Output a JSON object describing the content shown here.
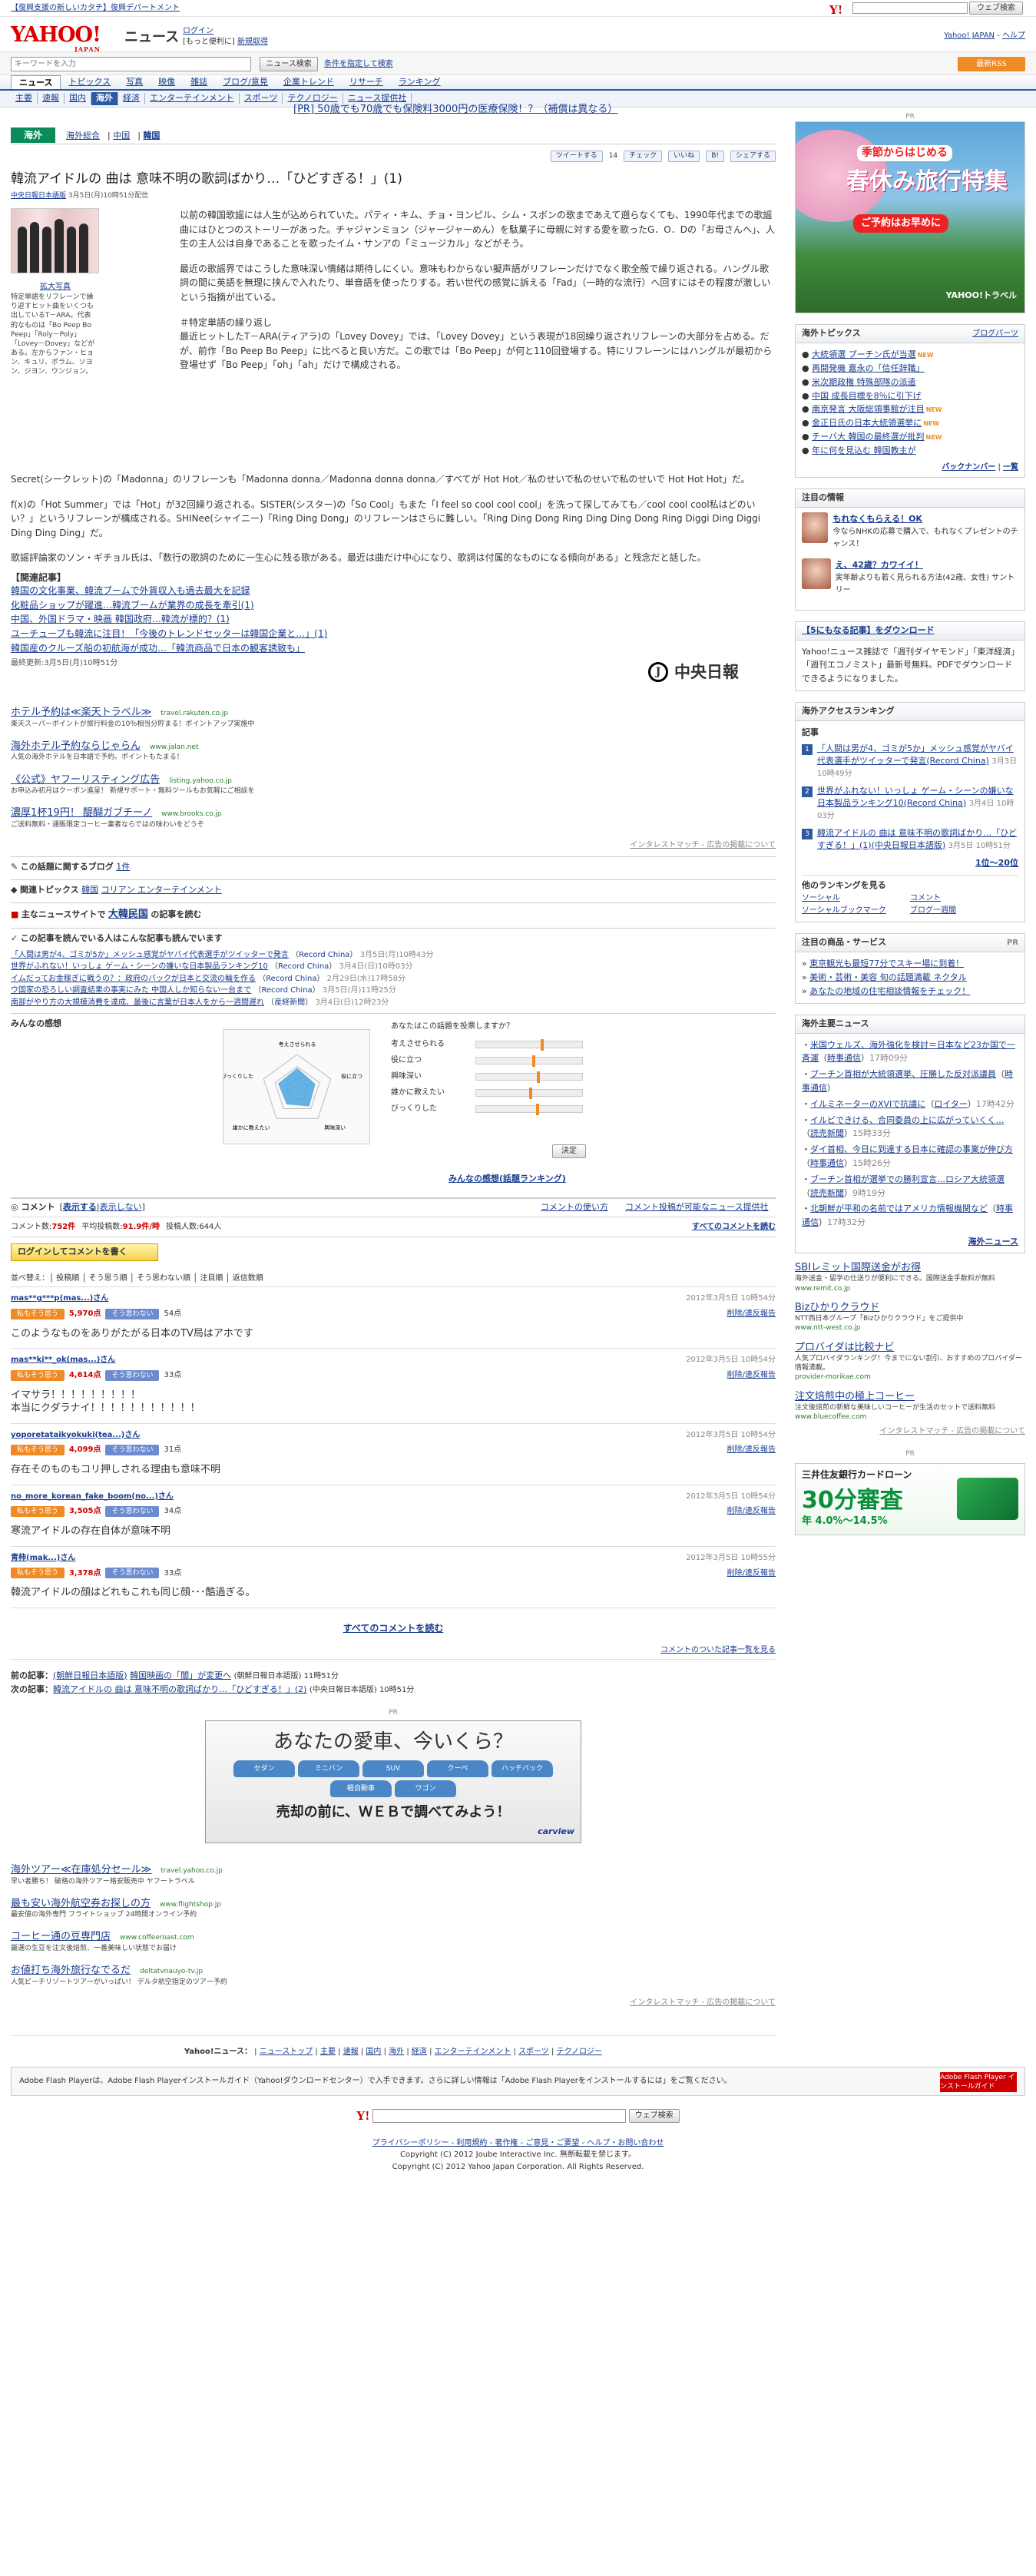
{
  "topbar": {
    "notice": "【復興支援の新しいカタチ】復興デパートメント",
    "search_btn": "ウェブ検索"
  },
  "header": {
    "logo": "YAHOO!",
    "logo_sub": "JAPAN",
    "title": "ニュース",
    "login": "ログイン",
    "login_sub": "[もっと便利に]",
    "signup": "新規取得",
    "yahoo_top": "Yahoo! JAPAN",
    "help": "ヘルプ"
  },
  "search": {
    "placeholder": "キーワードを入力",
    "button": "ニュース検索",
    "cond": "条件を指定して検索",
    "rss": "最新RSS"
  },
  "nav1": [
    "ニュース",
    "トピックス",
    "写真",
    "映像",
    "雑誌",
    "ブログ/意見",
    "企業トレンド",
    "リサーチ",
    "ランキング"
  ],
  "nav2": [
    "主要",
    "速報",
    "国内",
    "海外",
    "経済",
    "エンターテインメント",
    "スポーツ",
    "テクノロジー",
    "ニュース提供社"
  ],
  "category": {
    "label": "海外",
    "links": [
      "海外総合",
      "中国",
      "韓国"
    ]
  },
  "pr_top": "[PR] 50歳でも70歳でも保険料3000円の医療保険！？（補償は異なる）",
  "share": {
    "tweet": "ツイートする",
    "count": "14",
    "check": "チェック",
    "like": "いいね",
    "hatena": "B!",
    "share": "シェアする"
  },
  "article": {
    "title": "韓流アイドルの 曲は 意味不明の歌詞ばかり…「ひどすぎる！」(1)",
    "source": "中央日報日本語版",
    "date": "3月5日(月)10時51分配信",
    "caption_link": "拡大写真",
    "caption": "特定単語をリフレーンで繰り返すヒット曲をいくつも出しているT－ARA。代表的なものは「Bo Peep Bo Peep」「Roly－Poly」「Lovey－Dovey」などがある。左からファン・ヒョン、キュリ、ボラム、ソヨン、ジヨン、ウンジョン。",
    "p1": "以前の韓国歌謡には人生が込められていた。パティ・キム、チョ・ヨンピル、シム・スボンの歌まであえて遡らなくても、1990年代までの歌謡曲にはひとつのストーリーがあった。チャジャンミョン（ジャージャーめん）を駄菓子に母親に対する愛を歌ったG．O．Dの「お母さんへ」、人生の主人公は自身であることを歌ったイム・サンアの「ミュージカル」などがそう。",
    "p2": "最近の歌謡界ではこうした意味深い情緒は期待しにくい。意味もわからない擬声語がリフレーンだけでなく歌全般で繰り返される。ハングル歌詞の間に英語を無理に挟んで入れたり、単音語を使ったりする。若い世代の感覚に訴える「Fad」（一時的な流行）へ回すにはその程度が激しいという指摘が出ている。",
    "p3": "＃特定単語の繰り返し",
    "p4": "最近ヒットしたT－ARA(ティアラ)の「Lovey Dovey」では、「Lovey Dovey」という表現が18回繰り返されリフレーンの大部分を占める。だが、前作「Bo Peep Bo Peep」に比べると良い方だ。この歌では「Bo Peep」が何と110回登場する。特にリフレーンにはハングルが最初から登場せず「Bo Peep」「oh」「ah」だけで構成される。",
    "p5": "Secret(シークレット)の「Madonna」のリフレーンも「Madonna donna／Madonna donna donna／すべてが Hot Hot／私のせいで私のせいで私のせいで Hot Hot Hot」だ。",
    "p6": "f(x)の「Hot Summer」では「Hot」が32回繰り返される。SISTER(シスター)の「So Cool」もまた「I feel so cool cool cool」を洗って探してみても／cool cool cool私はどのいい？」というリフレーンが構成される。SHINee(シャイニー)「Ring Ding Dong」のリフレーンはさらに難しい。「Ring Ding Dong Ring Ding Ding Dong Ring Diggi Ding Diggi Ding Ding Ding」だ。",
    "p7": "歌謡評論家のソン・ギチョル氏は、「数行の歌詞のために一生心に残る歌がある。最近は曲だけ中心になり、歌詞は付属的なものになる傾向がある」と残念だと話した。",
    "related_title": "【関連記事】",
    "related": [
      "韓国の文化事業、韓流ブームで外貨収入も過去最大を記録",
      "化粧品ショップが躍進…韓流ブームが業界の成長を牽引(1)",
      "中国、外国ドラマ・映画 韓国政府…韓流が標的？(1)",
      "ユーチューブも韓流に注目！「今後のトレンドセッターは韓国企業と…」(1)",
      "韓国産のクルーズ船の初航海が成功…「韓流商品で日本の観客誘致も」"
    ],
    "updated": "最終更新:3月5日(月)10時51分",
    "publisher_logo": "中央日報"
  },
  "ads_mid": [
    {
      "title": "ホテル予約は≪楽天トラベル≫",
      "url": "travel.rakuten.co.jp",
      "desc": "楽天スーパーポイントが旅行料金の10％相当分貯まる！ポイントアップ実施中"
    },
    {
      "title": "海外ホテル予約ならじゃらん",
      "url": "www.jalan.net",
      "desc": "人気の海外ホテルを日本語で予約。ポイントもたまる！"
    },
    {
      "title": "《公式》ヤフーリスティング広告",
      "url": "listing.yahoo.co.jp",
      "desc": "お申込み初月はクーポン進呈！ 新規サポート・無料ツールもお気軽にご相談を"
    },
    {
      "title": "濃厚1杯19円！ 醍醐ガブチーノ",
      "url": "www.brooks.co.jp",
      "desc": "ご送料無料・通販限定コーヒー業者ならではの味わいをどうぞ"
    }
  ],
  "ad_marker": "インタレストマッチ - 広告の掲載について",
  "blog": {
    "label": "この話題に関するブログ",
    "count": "1件"
  },
  "topics": {
    "label": "関連トピックス",
    "items": [
      "韓国",
      "コリアン エンターテインメント"
    ]
  },
  "othersite": {
    "label": "主なニュースサイトで",
    "name": "大韓民国",
    "suffix": "の記事を読む"
  },
  "alsoread": {
    "label": "この記事を読んでいる人はこんな記事も読んでいます",
    "items": [
      {
        "t": "「人間は男が4、ゴミが5か」メッシュ感覚がヤバイ代表選手がツイッターで発言",
        "s": "Record China",
        "d": "3月5日(月)10時43分"
      },
      {
        "t": "世界がふれない！いっしょ ゲーム・シーンの嫌いな日本製品ランキング10",
        "s": "Record China",
        "d": "3月4日(日)10時03分"
      },
      {
        "t": "イムだってお金稼ぎに戦うの？：政府のバックが日本と交流の輪を作る",
        "s": "Record China",
        "d": "2月29日(水)17時58分"
      },
      {
        "t": "ウ国家の恐ろしい調査結果の事実にみた 中国人しか知らない一台まで",
        "s": "Record China",
        "d": "3月5日(月)11時25分"
      },
      {
        "t": "南部がやり方の大規模消費を達成、最後に言葉が日本人をから一週間遅れ",
        "s": "産経新聞",
        "d": "3月4日(日)12時23分"
      }
    ]
  },
  "kanso": {
    "label": "みんなの感想",
    "question": "あなたはこの話題を投票しますか？",
    "axes": [
      "考えさせられる",
      "役に立つ",
      "興味深い",
      "誰かに教えたい",
      "びっくりした"
    ],
    "levels": [
      0.62,
      0.54,
      0.58,
      0.51,
      0.57
    ],
    "submit": "決定",
    "ranklink": "みんなの感想(話題ランキング)"
  },
  "comments": {
    "title": "コメント",
    "show": "表示する",
    "hide": "表示しない",
    "howto": "コメントの使い方",
    "cantpost": "コメント投稿が可能なニュース提供社",
    "count_label": "コメント数:",
    "count": "752件",
    "avg_label": "平均投稿数:",
    "avg": "91.9件/時",
    "posters_label": "投稿人数:",
    "posters": "644人",
    "all": "すべてのコメントを読む",
    "login_btn": "ログインしてコメントを書く",
    "sort": "並べ替え：│ 投稿順 │ そう思う順 │ そう思わない順 │ 注目順 │ 返信数順",
    "agree_label": "私もそう思う",
    "disagree_label": "そう思わない",
    "report": "削除/違反報告",
    "items": [
      {
        "user": "mas**g***p(mas...)さん",
        "date": "2012年3月5日 10時54分",
        "agree": "5,970点",
        "disagree": "54点",
        "text": "このようなものをありがたがる日本のTV局はアホです"
      },
      {
        "user": "mas**ki**_ok(mas...)さん",
        "date": "2012年3月5日 10時54分",
        "agree": "4,614点",
        "disagree": "33点",
        "text": "イマサラ！！！！！！！！！\n本当にクダラナイ！！！！！！！！！！！"
      },
      {
        "user": "yoporetataikyokuki(tea...)さん",
        "date": "2012年3月5日 10時54分",
        "agree": "4,099点",
        "disagree": "31点",
        "text": "存在そのものもコリ押しされる理由も意味不明"
      },
      {
        "user": "no_more_korean_fake_boom(no...)さん",
        "date": "2012年3月5日 10時54分",
        "agree": "3,505点",
        "disagree": "34点",
        "text": "寒流アイドルの存在自体が意味不明"
      },
      {
        "user": "青柿(mak...)さん",
        "date": "2012年3月5日 10時55分",
        "agree": "3,378点",
        "disagree": "33点",
        "text": "韓流アイドルの顔はどれもこれも同じ顔･･･酷過ぎる。"
      }
    ],
    "all_bottom": "すべてのコメントを読む",
    "ranking_link": "コメントのついた記事一覧を見る"
  },
  "prevnext": {
    "prev_label": "前の記事：",
    "prev_source": "(朝鮮日報日本語版)",
    "prev_title": "韓国映画の「闇」が変更へ",
    "prev_meta": "(朝鮮日報日本語版) 11時51分",
    "next_label": "次の記事：",
    "next_title": "韓流アイドルの 曲は 意味不明の歌詞ばかり…「ひどすぎる！」(2)",
    "next_meta": "(中央日報日本語版) 10時51分"
  },
  "carad": {
    "pr": "PR",
    "t1": "あなたの愛車、今いくら？",
    "cars": [
      "セダン",
      "ミニバン",
      "SUV",
      "クーペ",
      "ハッチバック",
      "軽自動車",
      "ワゴン"
    ],
    "t2": "売却の前に、ＷＥＢで調べてみよう！",
    "brand": "carview"
  },
  "ads_bottom": [
    {
      "title": "海外ツアー≪在庫処分セール≫",
      "url": "travel.yahoo.co.jp",
      "desc": "早い者勝ち！ 破格の海外ツアー格安販売中 ヤフートラベル"
    },
    {
      "title": "最も安い海外航空券お探しの方",
      "url": "www.flightshop.jp",
      "desc": "最安値の海外専門 フライトショップ 24時間オンライン予約"
    },
    {
      "title": "コーヒー通の豆専門店",
      "url": "www.coffeeroast.com",
      "desc": "厳選の生豆を注文後焙煎、一番美味しい状態でお届け"
    },
    {
      "title": "お値打ち海外旅行なでるだ",
      "url": "deltatvnauyo-tv.jp",
      "desc": "人気ビーチリゾートツアーがいっぱい！ デルタ航空指定のツアー予約"
    }
  ],
  "footnav": {
    "label": "Yahoo!ニュース：",
    "items": [
      "ニューストップ",
      "主要",
      "速報",
      "国内",
      "海外",
      "経済",
      "エンターテインメント",
      "スポーツ",
      "テクノロジー"
    ]
  },
  "flash": {
    "text": "Adobe Flash Playerは、Adobe Flash Playerインストールガイド（Yahoo!ダウンロードセンター）で入手できます。さらに詳しい情報は「Adobe Flash Playerをインストールするには」をご覧ください。",
    "badge": "Adobe Flash Player インストールガイド"
  },
  "bottom_search": {
    "btn": "ウェブ検索"
  },
  "footer": {
    "links": "プライバシーポリシー - 利用規約 - 著作権 - ご意見・ご要望 - ヘルプ・お問い合わせ",
    "c1": "Copyright (C) 2012 Joube Interactive Inc. 無断転載を禁じます。",
    "c2": "Copyright (C) 2012 Yahoo Japan Corporation. All Rights Reserved."
  },
  "side": {
    "pr_label": "PR",
    "ad_t1": "季節からはじめる",
    "ad_t2": "春休み旅行特集",
    "ad_t3": "ご予約はお早めに",
    "ad_brand": "YAHOO!トラベル",
    "topics_title": "海外トピックス",
    "topics_more": "ブログパーツ",
    "topics": [
      {
        "t": "大統領選 プーチン氏が当選",
        "n": true
      },
      {
        "t": "再開発機 嘉永の「信任辞職」",
        "n": false
      },
      {
        "t": "米次期政権 特殊部隊の派遣",
        "n": false
      },
      {
        "t": "中国 成長目標を8％に引下げ",
        "n": false
      },
      {
        "t": "南京発言 大阪総領事館が注目",
        "n": true
      },
      {
        "t": "金正日氏の日本大統領選挙に",
        "n": true
      },
      {
        "t": "チーバ大 韓国の最終選が批判",
        "n": true
      },
      {
        "t": "年に何を見込む 韓国教主が",
        "n": false
      }
    ],
    "backnumber": "バックナンバー",
    "list": "一覧",
    "info_title": "注目の情報",
    "info": [
      {
        "t": "もれなくもらえる！OK",
        "d": "今ならNHKの応募で購入で、もれなくプレゼントのチャンス！"
      },
      {
        "t": "え、42歳？カワイイ！",
        "d": "実年齢よりも若く見られる方法(42歳、女性) サントリー"
      }
    ],
    "dl_title": "【5にもなる記事】をダウンロード",
    "dl_text": "Yahoo!ニュース雑誌で「週刊ダイヤモンド」「東洋経済」「週刊エコノミスト」最新号無料。PDFでダウンロードできるようになりました。",
    "rank_title": "海外アクセスランキング",
    "rank_sub": "記事",
    "ranks": [
      {
        "t": "「人間は男が4、ゴミが5か」メッシュ感覚がヤバイ代表選手がツイッターで発言(Record China)",
        "d": "3月3日 10時49分"
      },
      {
        "t": "世界がふれない！いっしょ ゲーム・シーンの嫌いな日本製品ランキング10(Record China)",
        "d": "3月4日 10時03分"
      },
      {
        "t": "韓流アイドルの 曲は 意味不明の歌詞ばかり…「ひどすぎる！」(1)(中央日報日本語版)",
        "d": "3月5日 10時51分"
      }
    ],
    "rank_more": "1位〜20位",
    "other_title": "他のランキングを見る",
    "other": [
      "ソーシャル",
      "コメント",
      "ソーシャルブックマーク",
      "ブログ一週間"
    ],
    "pick_title": "注目の商品・サービス",
    "picks": [
      "東京観光も最短77分でスキー場に到着！",
      "美術・芸術・美容 旬の話題満載 ネクタル",
      "あなたの地域の住宅相談情報をチェック！"
    ],
    "world_title": "海外主要ニュース",
    "world": [
      {
        "t": "米国ウェルズ、海外強化を検討＝日本など23か国で一斉運",
        "s": "時事通信",
        "d": "17時09分"
      },
      {
        "t": "プーチン首相が大統領選挙、圧勝した反対派議員",
        "s": "時事通信",
        "d": ""
      },
      {
        "t": "イルミネーターのXVIで抗議に",
        "s": "ロイター",
        "d": "17時42分"
      },
      {
        "t": "イルビできける、合同委員の上に広がっていくく…",
        "s": "読売新聞",
        "d": "15時33分"
      },
      {
        "t": "ダイ首相、今日に到達する日本に確認の事業が伸び方",
        "s": "時事通信",
        "d": "15時26分"
      },
      {
        "t": "ブーチン首相が選挙での勝利宣言…ロシア大統領選",
        "s": "読売新聞",
        "d": "9時19分"
      },
      {
        "t": "北朝鮮が平和の名前ではアメリカ情報機関など",
        "s": "時事通信",
        "d": "17時32分"
      }
    ],
    "world_more": "海外ニュース",
    "ads": [
      {
        "t": "SBIレミット国際送金がお得",
        "d": "海外送金・留学の仕送りが便利にできる。国際送金手数料が無料",
        "u": "www.remit.co.jp"
      },
      {
        "t": "Bizひかりクラウド",
        "d": "NTT西日本グループ「Bizひかりクラウド」をご提供中",
        "u": "www.ntt-west.co.jp"
      },
      {
        "t": "プロバイダは比較ナビ",
        "d": "人気プロバイダランキング！今までにない割引、おすすめのプロバイダー情報満載。",
        "u": "provider-morikae.com"
      },
      {
        "t": "注文焙煎中の極上コーヒー",
        "d": "注文後焙煎の新鮮な美味しいコーヒーが生活のセットで送料無料",
        "u": "www.bluecoffee.com"
      }
    ],
    "card_pr": "PR",
    "card_t1": "三井住友銀行カードローン",
    "card_t2": "30分審査",
    "card_t3": "年 4.0%〜14.5%"
  }
}
